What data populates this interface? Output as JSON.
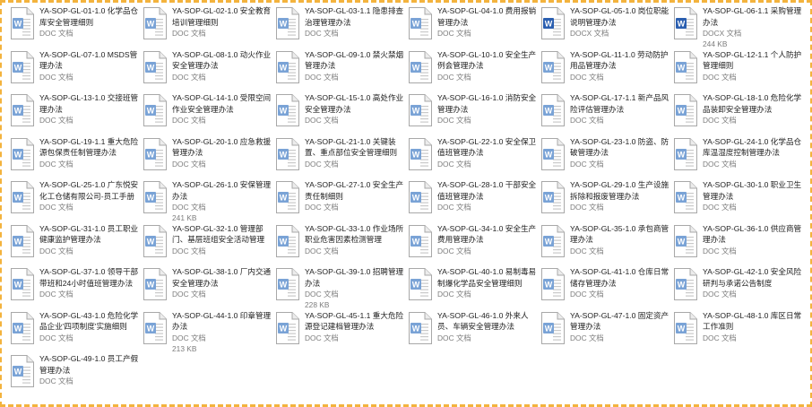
{
  "files": [
    {
      "name": "YA-SOP-GL-01-1.0 化学品仓库安全管理细则",
      "meta": "DOC 文档",
      "icon": "word-doc-icon"
    },
    {
      "name": "YA-SOP-GL-02-1.0 安全教育培训管理细则",
      "meta": "DOC 文档",
      "icon": "word-doc-icon"
    },
    {
      "name": "YA-SOP-GL-03-1.1 隐患排查治理管理办法",
      "meta": "DOC 文档",
      "icon": "word-doc-icon"
    },
    {
      "name": "YA-SOP-GL-04-1.0 费用报销管理办法",
      "meta": "DOC 文档",
      "icon": "word-doc-icon"
    },
    {
      "name": "YA-SOP-GL-05-1.0 岗位职能说明管理办法",
      "meta": "DOCX 文档",
      "icon": "word-docx-icon"
    },
    {
      "name": "YA-SOP-GL-06-1.1 采购管理办法",
      "meta": "DOCX 文档",
      "meta2": "244 KB",
      "icon": "word-docx-icon"
    },
    {
      "name": "YA-SOP-GL-07-1.0 MSDS管理办法",
      "meta": "DOC 文档",
      "icon": "word-doc-icon"
    },
    {
      "name": "YA-SOP-GL-08-1.0 动火作业安全管理办法",
      "meta": "DOC 文档",
      "icon": "word-doc-icon"
    },
    {
      "name": "YA-SOP-GL-09-1.0 禁火禁烟管理办法",
      "meta": "DOC 文档",
      "icon": "word-doc-icon"
    },
    {
      "name": "YA-SOP-GL-10-1.0 安全生产例会管理办法",
      "meta": "DOC 文档",
      "icon": "word-doc-icon"
    },
    {
      "name": "YA-SOP-GL-11-1.0 劳动防护用品管理办法",
      "meta": "DOC 文档",
      "icon": "word-doc-icon"
    },
    {
      "name": "YA-SOP-GL-12-1.1 个人防护管理细则",
      "meta": "DOC 文档",
      "icon": "word-doc-icon"
    },
    {
      "name": "YA-SOP-GL-13-1.0 交接班管理办法",
      "meta": "DOC 文档",
      "icon": "word-doc-icon"
    },
    {
      "name": "YA-SOP-GL-14-1.0 受限空间作业安全管理办法",
      "meta": "DOC 文档",
      "icon": "word-doc-icon"
    },
    {
      "name": "YA-SOP-GL-15-1.0 高处作业安全管理办法",
      "meta": "DOC 文档",
      "icon": "word-doc-icon"
    },
    {
      "name": "YA-SOP-GL-16-1.0 消防安全管理办法",
      "meta": "DOC 文档",
      "icon": "word-doc-icon"
    },
    {
      "name": "YA-SOP-GL-17-1.1 新产品风险评估管理办法",
      "meta": "DOC 文档",
      "icon": "word-doc-icon"
    },
    {
      "name": "YA-SOP-GL-18-1.0 危险化学品装卸安全管理办法",
      "meta": "DOC 文档",
      "icon": "word-doc-icon"
    },
    {
      "name": "YA-SOP-GL-19-1.1 重大危险源包保责任制管理办法",
      "meta": "DOC 文档",
      "icon": "word-doc-icon"
    },
    {
      "name": "YA-SOP-GL-20-1.0 应急救援管理办法",
      "meta": "DOC 文档",
      "icon": "word-doc-icon"
    },
    {
      "name": "YA-SOP-GL-21-1.0 关键装置、重点部位安全管理细则",
      "meta": "DOC 文档",
      "icon": "word-doc-icon"
    },
    {
      "name": "YA-SOP-GL-22-1.0 安全保卫值班管理办法",
      "meta": "DOC 文档",
      "icon": "word-doc-icon"
    },
    {
      "name": "YA-SOP-GL-23-1.0 防盗、防破管理办法",
      "meta": "DOC 文档",
      "icon": "word-doc-icon"
    },
    {
      "name": "YA-SOP-GL-24-1.0 化学品仓库温湿度控制管理办法",
      "meta": "DOC 文档",
      "icon": "word-doc-icon"
    },
    {
      "name": "YA-SOP-GL-25-1.0 广东悦安化工仓储有限公司-员工手册",
      "meta": "DOC 文档",
      "icon": "word-doc-icon"
    },
    {
      "name": "YA-SOP-GL-26-1.0 安保管理办法",
      "meta": "DOC 文档",
      "meta2": "241 KB",
      "icon": "word-doc-icon"
    },
    {
      "name": "YA-SOP-GL-27-1.0 安全生产责任制细则",
      "meta": "DOC 文档",
      "icon": "word-doc-icon"
    },
    {
      "name": "YA-SOP-GL-28-1.0 干部安全值班管理办法",
      "meta": "DOC 文档",
      "icon": "word-doc-icon"
    },
    {
      "name": "YA-SOP-GL-29-1.0 生产设施拆除和报废管理办法",
      "meta": "DOC 文档",
      "icon": "word-doc-icon"
    },
    {
      "name": "YA-SOP-GL-30-1.0 职业卫生管理办法",
      "meta": "DOC 文档",
      "icon": "word-doc-icon"
    },
    {
      "name": "YA-SOP-GL-31-1.0 员工职业健康监护管理办法",
      "meta": "DOC 文档",
      "icon": "word-doc-icon"
    },
    {
      "name": "YA-SOP-GL-32-1.0 管理部门、基层班组安全活动管理办法",
      "meta": "DOC 文档",
      "icon": "word-doc-icon"
    },
    {
      "name": "YA-SOP-GL-33-1.0 作业场所职业危害因素检测管理",
      "meta": "DOC 文档",
      "icon": "word-doc-icon"
    },
    {
      "name": "YA-SOP-GL-34-1.0 安全生产费用管理办法",
      "meta": "DOC 文档",
      "icon": "word-doc-icon"
    },
    {
      "name": "YA-SOP-GL-35-1.0 承包商管理办法",
      "meta": "DOC 文档",
      "icon": "word-doc-icon"
    },
    {
      "name": "YA-SOP-GL-36-1.0 供应商管理办法",
      "meta": "DOC 文档",
      "icon": "word-doc-icon"
    },
    {
      "name": "YA-SOP-GL-37-1.0 领导干部带班和24小时值班管理办法",
      "meta": "DOC 文档",
      "icon": "word-doc-icon"
    },
    {
      "name": "YA-SOP-GL-38-1.0 厂内交通安全管理办法",
      "meta": "DOC 文档",
      "icon": "word-doc-icon"
    },
    {
      "name": "YA-SOP-GL-39-1.0 招聘管理办法",
      "meta": "DOC 文档",
      "meta2": "228 KB",
      "icon": "word-doc-icon"
    },
    {
      "name": "YA-SOP-GL-40-1.0 易制毒易制爆化学品安全管理细则",
      "meta": "DOC 文档",
      "icon": "word-doc-icon"
    },
    {
      "name": "YA-SOP-GL-41-1.0 仓库日常储存管理办法",
      "meta": "DOC 文档",
      "icon": "word-doc-icon"
    },
    {
      "name": "YA-SOP-GL-42-1.0 安全风险研判与承诺公告制度",
      "meta": "DOC 文档",
      "icon": "word-doc-icon"
    },
    {
      "name": "YA-SOP-GL-43-1.0 危险化学品企业'四项制度'实施细则",
      "meta": "DOC 文档",
      "icon": "word-doc-icon"
    },
    {
      "name": "YA-SOP-GL-44-1.0 印章管理办法",
      "meta": "DOC 文档",
      "meta2": "213 KB",
      "icon": "word-doc-icon"
    },
    {
      "name": "YA-SOP-GL-45-1.1 重大危险源登记建档管理办法",
      "meta": "DOC 文档",
      "icon": "word-doc-icon"
    },
    {
      "name": "YA-SOP-GL-46-1.0 外来人员、车辆安全管理办法",
      "meta": "DOC 文档",
      "icon": "word-doc-icon"
    },
    {
      "name": "YA-SOP-GL-47-1.0 固定资产管理办法",
      "meta": "DOC 文档",
      "icon": "word-doc-icon"
    },
    {
      "name": "YA-SOP-GL-48-1.0 库区日常工作准则",
      "meta": "DOC 文档",
      "icon": "word-doc-icon"
    },
    {
      "name": "YA-SOP-GL-49-1.0 员工产假管理办法",
      "meta": "DOC 文档",
      "icon": "word-doc-icon"
    }
  ],
  "colors": {
    "frame": "#f3b33d",
    "doc_icon": "#7aa3d6",
    "docx_icon": "#2b5fb0"
  }
}
